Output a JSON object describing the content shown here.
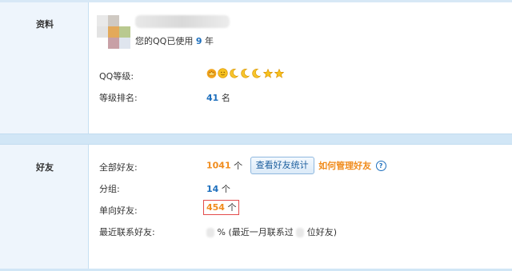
{
  "profile": {
    "section_title": "资料",
    "qq_years_prefix": "您的QQ已使用",
    "qq_years_value": "9",
    "qq_years_suffix": "年",
    "level_label": "QQ等级:",
    "level_icons": [
      "crown-icon",
      "sun-icon",
      "moon-icon",
      "moon-icon",
      "moon-icon",
      "star-icon",
      "star-icon"
    ],
    "rank_label": "等级排名:",
    "rank_value": "41",
    "rank_unit": "名"
  },
  "friends": {
    "section_title": "好友",
    "all_label": "全部好友:",
    "all_value": "1041",
    "all_unit": "个",
    "stats_button": "查看好友统计",
    "manage_link": "如何管理好友",
    "groups_label": "分组:",
    "groups_value": "14",
    "groups_unit": "个",
    "oneway_label": "单向好友:",
    "oneway_value": "454",
    "oneway_unit": "个",
    "recent_label": "最近联系好友:",
    "recent_text_a": "% (最近一月联系过",
    "recent_text_b": "位好友)"
  },
  "colors": {
    "accent_blue": "#1d6fbd",
    "accent_orange": "#f08c1d",
    "label_bg": "#eef5fc",
    "highlight_border": "#e34b4b"
  }
}
